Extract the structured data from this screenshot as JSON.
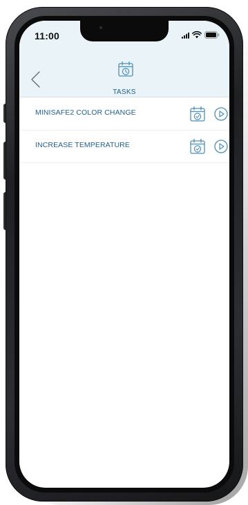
{
  "status_bar": {
    "time": "11:00"
  },
  "header": {
    "back_icon": "chevron-left-icon",
    "icon": "calendar-clock-icon",
    "title": "TASKS"
  },
  "tasks": [
    {
      "label": "MINISAFE2 COLOR CHANGE",
      "schedule_icon": "calendar-check-icon",
      "run_icon": "play-circle-icon"
    },
    {
      "label": "INCREASE TEMPERATURE",
      "schedule_icon": "calendar-check-icon",
      "run_icon": "play-circle-icon"
    }
  ],
  "colors": {
    "accent": "#1f5f8b",
    "header_bg": "#e9f3f8",
    "icon": "#4a8fb8"
  }
}
